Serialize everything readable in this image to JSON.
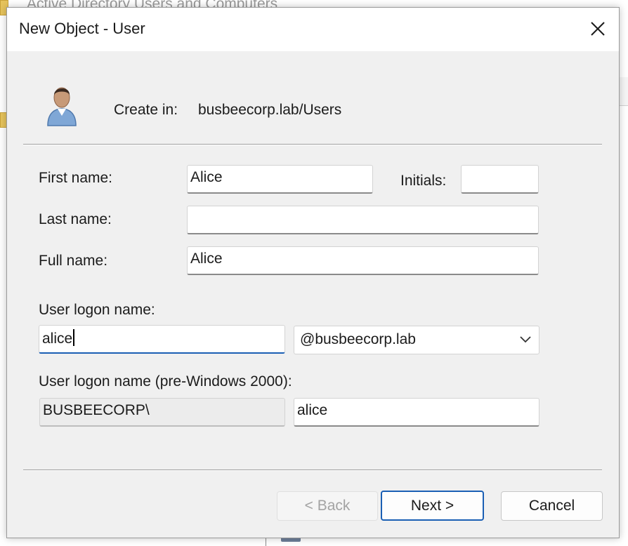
{
  "background": {
    "title": "Active Directory Users and Computers"
  },
  "dialog": {
    "title": "New Object - User",
    "create_in_label": "Create in:",
    "create_in_path": "busbeecorp.lab/Users",
    "first_name": {
      "label": "First name:",
      "value": "Alice"
    },
    "initials": {
      "label": "Initials:",
      "value": ""
    },
    "last_name": {
      "label": "Last name:",
      "value": ""
    },
    "full_name": {
      "label": "Full name:",
      "value": "Alice"
    },
    "logon_name": {
      "label": "User logon name:",
      "value": "alice",
      "domain_suffix": "@busbeecorp.lab"
    },
    "pre2000": {
      "label": "User logon name (pre-Windows 2000):",
      "domain": "BUSBEECORP\\",
      "value": "alice"
    },
    "buttons": {
      "back": "< Back",
      "next": "Next >",
      "cancel": "Cancel"
    }
  },
  "icons": [
    "close-icon",
    "user-icon",
    "chevron-down-icon"
  ],
  "colors": {
    "focus_accent": "#1a5fb4"
  }
}
